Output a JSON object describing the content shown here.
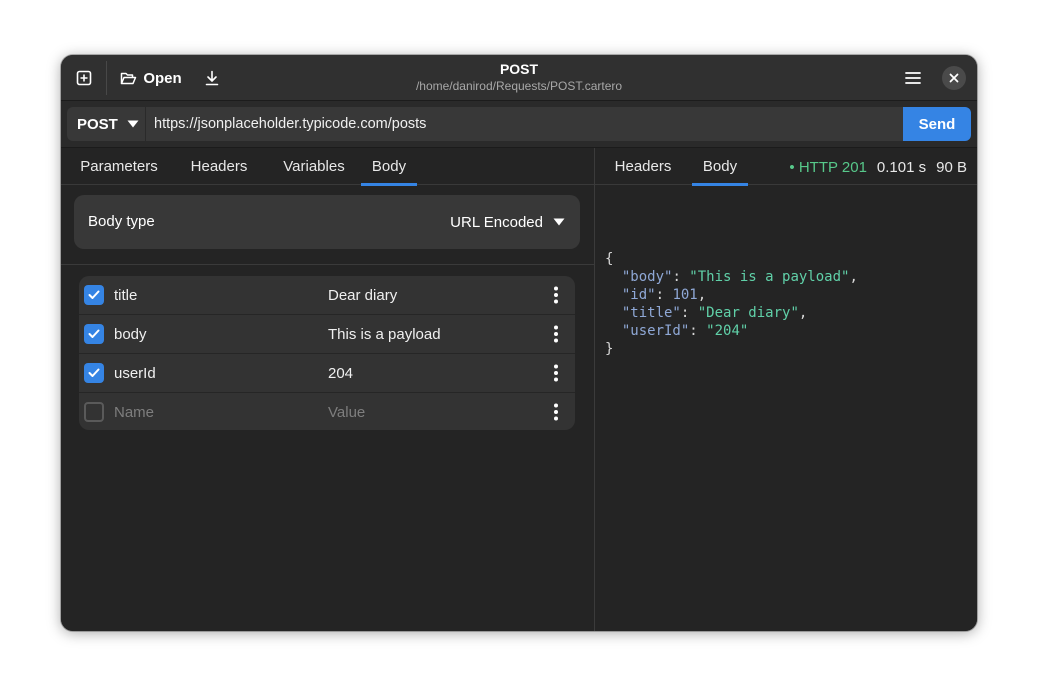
{
  "window": {
    "title": "POST",
    "subtitle": "/home/danirod/Requests/POST.cartero",
    "open_label": "Open"
  },
  "icons": {
    "new": "new-tab-icon",
    "open": "folder-open-icon",
    "save": "download-icon",
    "menu": "hamburger-menu-icon",
    "close": "close-icon"
  },
  "request": {
    "method": "POST",
    "url": "https://jsonplaceholder.typicode.com/posts",
    "send_label": "Send"
  },
  "request_tabs": [
    {
      "label": "Parameters",
      "active": false
    },
    {
      "label": "Headers",
      "active": false
    },
    {
      "label": "Variables",
      "active": false
    },
    {
      "label": "Body",
      "active": true
    }
  ],
  "body_type": {
    "label": "Body type",
    "value": "URL Encoded"
  },
  "body_fields": [
    {
      "name": "title",
      "value": "Dear diary",
      "checked": true
    },
    {
      "name": "body",
      "value": "This is a payload",
      "checked": true
    },
    {
      "name": "userId",
      "value": "204",
      "checked": true
    }
  ],
  "new_field": {
    "name_placeholder": "Name",
    "value_placeholder": "Value",
    "checked": false
  },
  "response_tabs": [
    {
      "label": "Headers",
      "active": false
    },
    {
      "label": "Body",
      "active": true
    }
  ],
  "response_status": {
    "code": "• HTTP 201",
    "time": "0.101 s",
    "size": "90 B"
  },
  "response_body": {
    "open": "{",
    "close": "}",
    "entries": [
      {
        "key": "\"body\"",
        "value": "\"This is a payload\"",
        "kind": "string",
        "comma": true
      },
      {
        "key": "\"id\"",
        "value": "101",
        "kind": "number",
        "comma": true
      },
      {
        "key": "\"title\"",
        "value": "\"Dear diary\"",
        "kind": "string",
        "comma": true
      },
      {
        "key": "\"userId\"",
        "value": "\"204\"",
        "kind": "string",
        "comma": false
      }
    ]
  },
  "colors": {
    "accent": "#3584e4",
    "status_ok": "#57c88a",
    "json_key": "#8fa8d6",
    "json_string": "#60d0a8"
  }
}
